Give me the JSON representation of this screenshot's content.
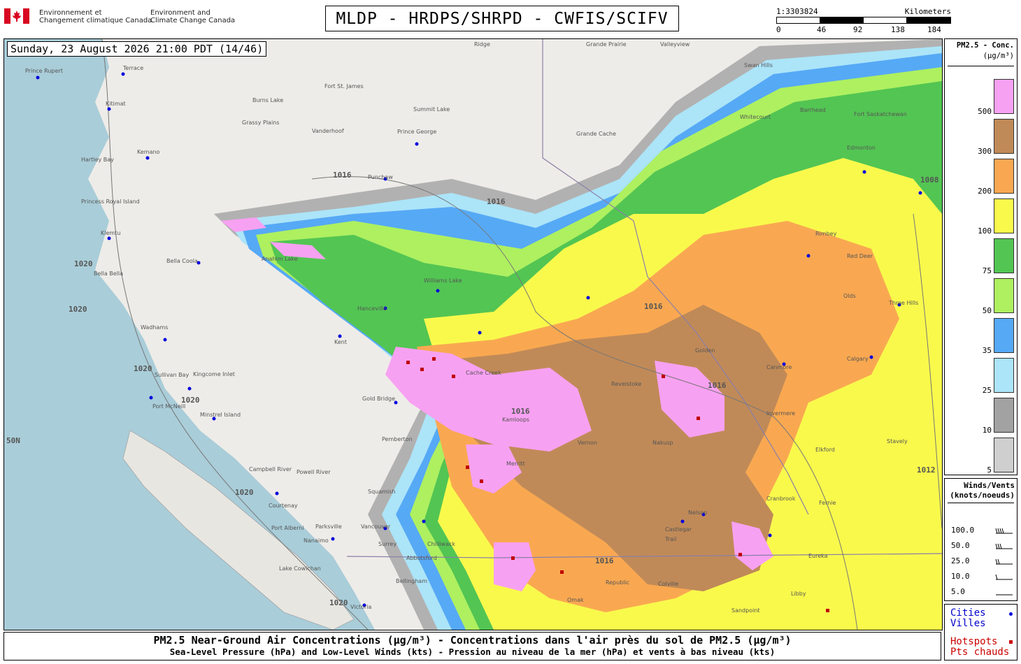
{
  "header": {
    "agency_fr": "Environnement et\nChangement climatique Canada",
    "agency_en": "Environment and\nClimate Change Canada",
    "title": "MLDP - HRDPS/SHRPD - CWFIS/SCIFV"
  },
  "scale_bar": {
    "ratio": "1:3303824",
    "unit": "Kilometers",
    "ticks": [
      "0",
      "46",
      "92",
      "138",
      "184"
    ]
  },
  "map": {
    "timestamp": "Sunday, 23 August 2026 21:00 PDT (14/46)",
    "lat_label": "50N",
    "isobar_labels": [
      "1016",
      "1016",
      "1016",
      "1016",
      "1016",
      "1016",
      "1020",
      "1020",
      "1020",
      "1020",
      "1020",
      "1020",
      "1008",
      "1012"
    ],
    "cities": [
      "Prince Rupert",
      "Terrace",
      "Kitimat",
      "Hartley Bay",
      "Kemano",
      "Princess Royal Island",
      "Klemtu",
      "Bella Bella",
      "Bella Coola",
      "Wadhams",
      "Sullivan Bay",
      "Kingcome Inlet",
      "Port McNeill",
      "Minstrel Island",
      "Campbell River",
      "Powell River",
      "Courtenay",
      "Port Alberni",
      "Parksville",
      "Nanaimo",
      "Lake Cowichan",
      "Victoria",
      "Vancouver",
      "Surrey",
      "Abbotsford",
      "Chilliwack",
      "Bellingham",
      "Squamish",
      "Pemberton",
      "Gold Bridge",
      "Kent",
      "Hanceville",
      "Williams Lake",
      "Anahim Lake",
      "Punchaw",
      "Prince George",
      "Vanderhoof",
      "Fort St. James",
      "Burns Lake",
      "Grassy Plains",
      "Summit Lake",
      "Ridge",
      "Grande Prairie",
      "Valleyview",
      "Grande Cache",
      "Swan Hills",
      "Whitecourt",
      "Barrhead",
      "Fort Saskatchewan",
      "Edmonton",
      "Cache Creek",
      "Kamloops",
      "Merritt",
      "Vernon",
      "Revelstoke",
      "Golden",
      "Nakusp",
      "Canmore",
      "Calgary",
      "Invermere",
      "Nelson",
      "Castlegar",
      "Trail",
      "Cranbrook",
      "Fernie",
      "Elkford",
      "Eureka",
      "Libby",
      "Sandpoint",
      "Colville",
      "Republic",
      "Omak",
      "Stavely",
      "Olds",
      "Red Deer",
      "Three Hills",
      "Rimbey"
    ]
  },
  "legend": {
    "title": "PM2.5 - Conc.",
    "unit": "(µg/m³)",
    "levels": [
      {
        "label": "500",
        "color": "#f7a1f2"
      },
      {
        "label": "300",
        "color": "#c08a58"
      },
      {
        "label": "200",
        "color": "#f9a851"
      },
      {
        "label": "100",
        "color": "#f9f94c"
      },
      {
        "label": "75",
        "color": "#53c553"
      },
      {
        "label": "50",
        "color": "#aef060"
      },
      {
        "label": "35",
        "color": "#56a9f5"
      },
      {
        "label": "25",
        "color": "#ace4f8"
      },
      {
        "label": "10",
        "color": "#a2a2a2"
      },
      {
        "label": "5",
        "color": "#cfcfcf"
      }
    ]
  },
  "winds_legend": {
    "title_line1": "Winds/Vents",
    "title_line2": "(knots/noeuds)",
    "rows": [
      "100.0",
      "50.0",
      "25.0",
      "10.0",
      "5.0"
    ]
  },
  "cities_legend": {
    "cities_en": "Cities",
    "cities_fr": "Villes",
    "hotspots_en": "Hotspots",
    "hotspots_fr": "Pts chauds"
  },
  "footer": {
    "line1": "PM2.5 Near-Ground Air Concentrations (µg/m³) - Concentrations dans l'air près du sol de PM2.5 (µg/m³)",
    "line2": "Sea-Level Pressure (hPa) and Low-Level Winds (kts) - Pression au niveau de la mer (hPa) et vents à bas niveau (kts)"
  }
}
